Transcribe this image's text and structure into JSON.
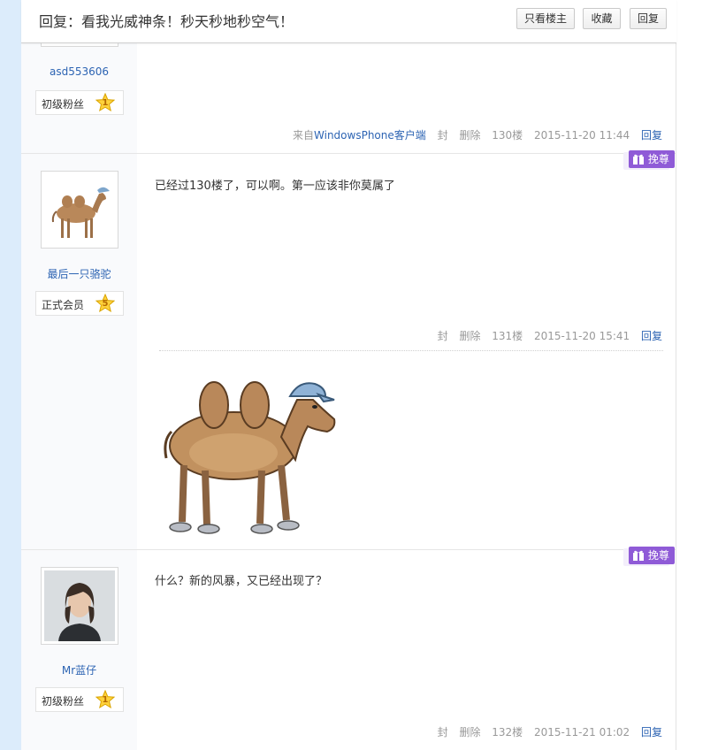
{
  "header": {
    "title": "回复：看我光威神条！秒天秒地秒空气！",
    "buttons": {
      "only_op": "只看楼主",
      "favorite": "收藏",
      "reply": "回复"
    }
  },
  "posts": [
    {
      "user": {
        "name": "asd553606",
        "level_title": "初级粉丝",
        "level": "1"
      },
      "meta": {
        "from_prefix": "来自",
        "from_client": "WindowsPhone客户端",
        "ban": "封",
        "delete": "删除",
        "floor": "130楼",
        "time": "2015-11-20 11:44",
        "reply": "回复"
      }
    },
    {
      "user": {
        "name": "最后一只骆驼",
        "level_title": "正式会员",
        "level": "5",
        "avatar_icon": "camel-avatar"
      },
      "content": "已经过130楼了，可以啊。第一应该非你莫属了",
      "reward_label": "挽尊",
      "meta": {
        "ban": "封",
        "delete": "删除",
        "floor": "131楼",
        "time": "2015-11-20 15:41",
        "reply": "回复"
      },
      "signature_image": "camel-with-cap"
    },
    {
      "user": {
        "name": "Mr蓝仔",
        "level_title": "初级粉丝",
        "level": "1",
        "avatar_icon": "person-avatar"
      },
      "content": "什么？新的风暴，又已经出现了？",
      "reward_label": "挽尊",
      "meta": {
        "ban": "封",
        "delete": "删除",
        "floor": "132楼",
        "time": "2015-11-21 01:02",
        "reply": "回复"
      }
    }
  ],
  "colors": {
    "link": "#2d64b3",
    "reward": "#8f5bd7",
    "sidebar": "#f9fafc",
    "left_strip": "#dcecfb"
  }
}
